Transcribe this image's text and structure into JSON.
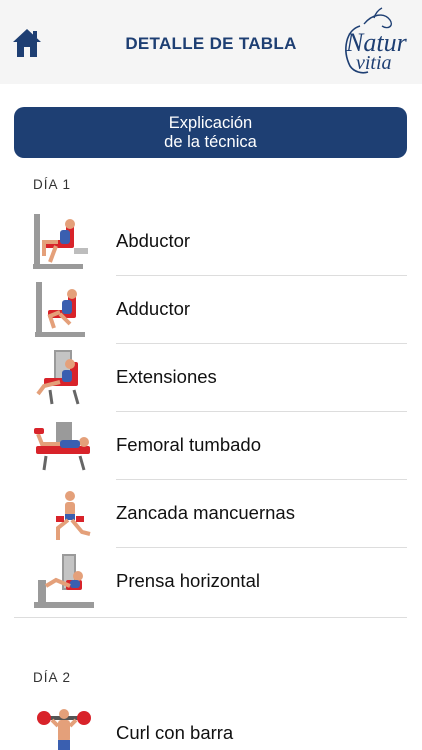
{
  "header": {
    "title": "DETALLE DE TABLA",
    "logo_line1": "Natur",
    "logo_line2": "vitia",
    "accent_color": "#1e3f73"
  },
  "technique_button": {
    "line1": "Explicación",
    "line2": "de la técnica"
  },
  "days": [
    {
      "label": "DÍA 1",
      "exercises": [
        {
          "name": "Abductor",
          "icon": "abductor-machine-icon"
        },
        {
          "name": "Adductor",
          "icon": "adductor-machine-icon"
        },
        {
          "name": "Extensiones",
          "icon": "leg-extension-machine-icon"
        },
        {
          "name": "Femoral tumbado",
          "icon": "lying-leg-curl-machine-icon"
        },
        {
          "name": "Zancada mancuernas",
          "icon": "dumbbell-lunge-icon"
        },
        {
          "name": "Prensa horizontal",
          "icon": "leg-press-machine-icon"
        }
      ]
    },
    {
      "label": "DÍA 2",
      "exercises": [
        {
          "name": "Curl con barra",
          "icon": "barbell-curl-icon"
        }
      ]
    }
  ]
}
